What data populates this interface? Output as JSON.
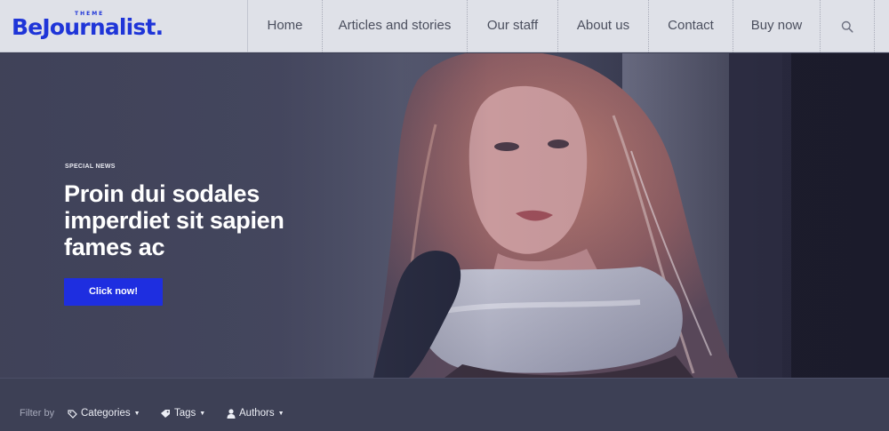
{
  "header": {
    "logo": "BeJournalist.",
    "logo_tag": "THEME",
    "nav": [
      "Home",
      "Articles and stories",
      "Our staff",
      "About us",
      "Contact",
      "Buy now"
    ],
    "search_icon": "search-icon"
  },
  "hero": {
    "eyebrow": "SPECIAL NEWS",
    "title": "Proin dui sodales imperdiet sit sapien fames ac",
    "button": "Click now!"
  },
  "filter": {
    "label": "Filter by",
    "items": [
      {
        "label": "Categories",
        "icon": "category-icon"
      },
      {
        "label": "Tags",
        "icon": "tag-icon"
      },
      {
        "label": "Authors",
        "icon": "user-icon"
      }
    ]
  },
  "colors": {
    "accent": "#1e2ee0",
    "header_bg": "#dfe1e8",
    "filter_bg": "#3d4055"
  }
}
